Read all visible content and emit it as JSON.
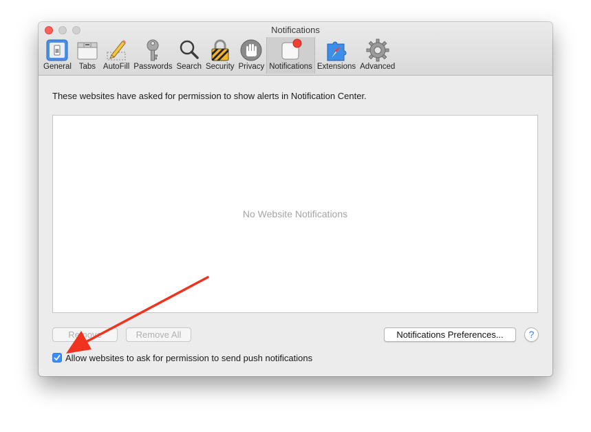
{
  "window": {
    "title": "Notifications",
    "tabs": [
      {
        "label": "General",
        "icon": "general-switch-icon"
      },
      {
        "label": "Tabs",
        "icon": "tabs-icon"
      },
      {
        "label": "AutoFill",
        "icon": "autofill-pencil-icon"
      },
      {
        "label": "Passwords",
        "icon": "key-icon"
      },
      {
        "label": "Search",
        "icon": "magnifier-icon"
      },
      {
        "label": "Security",
        "icon": "padlock-icon"
      },
      {
        "label": "Privacy",
        "icon": "hand-icon"
      },
      {
        "label": "Notifications",
        "icon": "notifications-badge-icon",
        "active": true
      },
      {
        "label": "Extensions",
        "icon": "puzzle-compass-icon"
      },
      {
        "label": "Advanced",
        "icon": "gear-icon"
      }
    ]
  },
  "main": {
    "description": "These websites have asked for permission to show alerts in Notification Center.",
    "empty_text": "No Website Notifications",
    "remove_label": "Remove",
    "remove_all_label": "Remove All",
    "prefs_label": "Notifications Preferences...",
    "help_label": "?",
    "checkbox_label": "Allow websites to ask for permission to send push notifications",
    "checkbox_checked": true
  },
  "colors": {
    "accent": "#3b8ef7",
    "annotation_arrow": "#f0331f"
  }
}
